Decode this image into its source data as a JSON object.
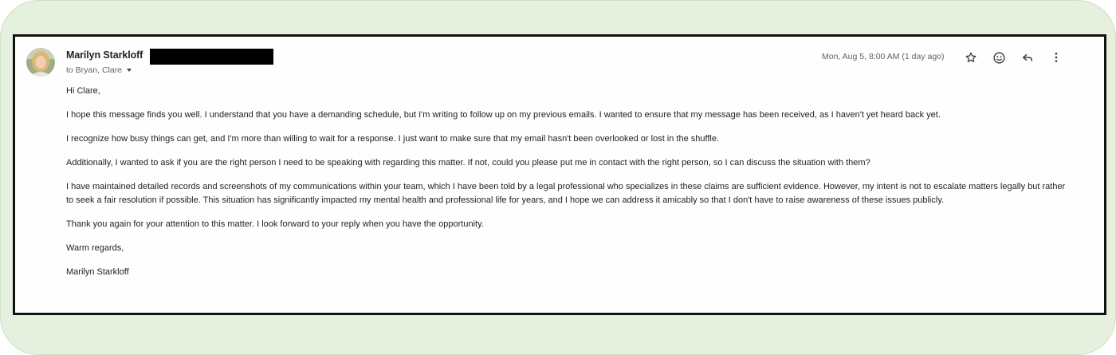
{
  "email": {
    "sender_name": "Marilyn Starkloff",
    "recipients_label": "to Bryan, Clare",
    "timestamp": "Mon, Aug 5, 8:00 AM (1 day ago)",
    "greeting": "Hi Clare,",
    "paragraphs": [
      "I hope this message finds you well. I understand that you have a demanding schedule, but I'm writing to follow up on my previous emails. I wanted to ensure that my message has been received, as I haven't yet heard back yet.",
      "I recognize how busy things can get, and I'm more than willing to wait for a response. I just want to make sure that my email hasn't been overlooked or lost in the shuffle.",
      "Additionally, I wanted to ask if you are the right person I need to be speaking with regarding this matter. If not, could you please put me in contact with the right person, so I can discuss the situation with them?",
      "I have maintained detailed records and screenshots of my communications within your team, which I have been told by a legal professional who specializes in these claims are sufficient evidence. However, my intent is not to escalate matters legally but rather to seek a fair resolution if possible. This situation has significantly impacted my mental health and professional life for years,  and I hope we can address it amicably so that I don't have to raise awareness of these issues publicly.",
      "Thank you again for your attention to this matter. I look forward to your reply when you have the opportunity."
    ],
    "closing": "Warm regards,",
    "signature": "Marilyn Starkloff"
  },
  "actions": [
    {
      "name": "star",
      "icon": "star-icon"
    },
    {
      "name": "react",
      "icon": "emoji-icon"
    },
    {
      "name": "reply",
      "icon": "reply-icon"
    },
    {
      "name": "more",
      "icon": "more-vert-icon"
    }
  ],
  "colors": {
    "outer_background": "#e6f0df",
    "frame_border": "#111111",
    "text": "#222222",
    "muted_text": "#5f6368",
    "redaction": "#000000"
  }
}
